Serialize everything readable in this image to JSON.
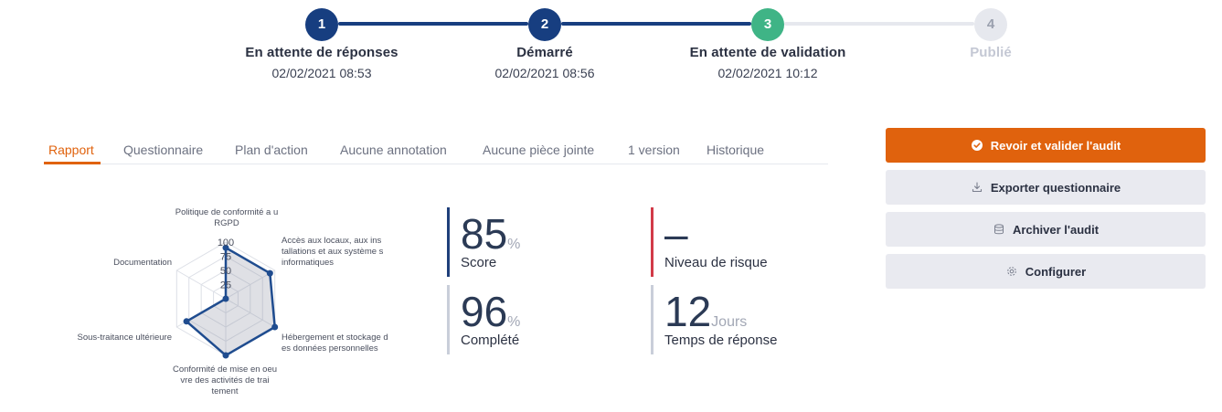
{
  "stepper": {
    "colors": {
      "done": "#173e80",
      "current": "#3fb486",
      "pending": "#e6e8ee",
      "pending_text": "#9aa0ae"
    },
    "steps": [
      {
        "number": "1",
        "title": "En attente de réponses",
        "date": "02/02/2021 08:53",
        "state": "done"
      },
      {
        "number": "2",
        "title": "Démarré",
        "date": "02/02/2021 08:56",
        "state": "done"
      },
      {
        "number": "3",
        "title": "En attente de validation",
        "date": "02/02/2021 10:12",
        "state": "current"
      },
      {
        "number": "4",
        "title": "Publié",
        "date": "",
        "state": "pending"
      }
    ]
  },
  "tabs": [
    {
      "label": "Rapport",
      "active": true
    },
    {
      "label": "Questionnaire",
      "active": false
    },
    {
      "label": "Plan d'action",
      "active": false
    },
    {
      "label": "Aucune annotation",
      "active": false
    },
    {
      "label": "Aucune pièce jointe",
      "active": false
    },
    {
      "label": "1 version",
      "active": false
    },
    {
      "label": "Historique",
      "active": false
    }
  ],
  "chart_data": {
    "type": "radar",
    "axes": [
      "Politique de conformité a u RGPD",
      "Accès aux locaux, aux ins tallations et aux système s informatiques",
      "Hébergement et stockage d es données personnelles",
      "Conformité de mise en oeu vre des activités de trai tement",
      "Sous-traitance ultérieure",
      "Documentation"
    ],
    "values": [
      90,
      90,
      100,
      100,
      80,
      0
    ],
    "ticks": [
      "25",
      "50",
      "75",
      "100"
    ],
    "range": [
      0,
      100
    ],
    "series_color": "#1f4c8f"
  },
  "kpis": [
    {
      "value": "85",
      "unit": "%",
      "label": "Score",
      "accent": "#1f3f7a"
    },
    {
      "value": "–",
      "unit": "",
      "label": "Niveau de risque",
      "accent": "#d23a48"
    },
    {
      "value": "96",
      "unit": "%",
      "label": "Complété",
      "accent": "#c9ced9"
    },
    {
      "value": "12",
      "unit": "Jours",
      "label": "Temps de réponse",
      "accent": "#c9ced9"
    }
  ],
  "actions": {
    "validate": {
      "label": "Revoir et valider l'audit",
      "icon": "check-circle-icon"
    },
    "export": {
      "label": "Exporter questionnaire",
      "icon": "download-icon"
    },
    "archive": {
      "label": "Archiver l'audit",
      "icon": "database-icon"
    },
    "configure": {
      "label": "Configurer",
      "icon": "gear-icon"
    }
  }
}
